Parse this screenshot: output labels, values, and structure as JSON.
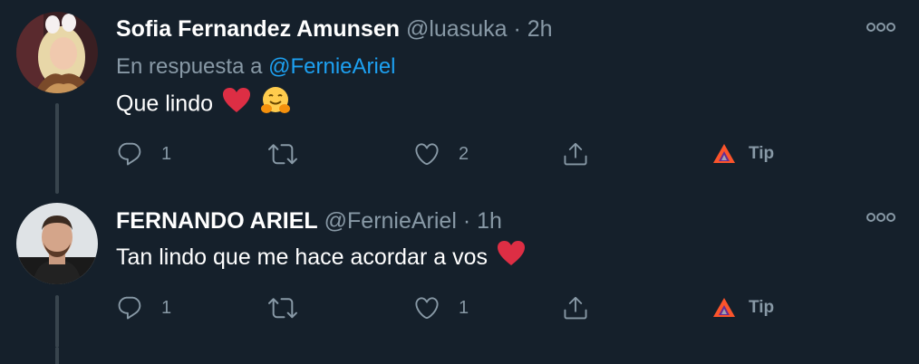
{
  "tweets": [
    {
      "name": "Sofia Fernandez Amunsen",
      "handle": "@luasuka",
      "separator": "·",
      "time": "2h",
      "replying_prefix": "En respuesta a",
      "replying_to": "@FernieAriel",
      "text": "Que lindo",
      "emojis": [
        "red-heart",
        "hugging-face"
      ],
      "replies": "1",
      "retweets": "",
      "likes": "2",
      "tip_label": "Tip"
    },
    {
      "name": "FERNANDO ARIEL",
      "handle": "@FernieAriel",
      "separator": "·",
      "time": "1h",
      "text": "Tan lindo que me hace acordar a vos",
      "emojis": [
        "red-heart"
      ],
      "replies": "1",
      "retweets": "",
      "likes": "1",
      "tip_label": "Tip"
    }
  ],
  "colors": {
    "background": "#15202b",
    "secondary_text": "#8899a6",
    "link": "#1da1f2",
    "thread_line": "#38444d",
    "heart": "#e0245e"
  },
  "icons": [
    "reply-icon",
    "retweet-icon",
    "like-icon",
    "share-icon",
    "brave-tip-icon",
    "more-icon"
  ]
}
